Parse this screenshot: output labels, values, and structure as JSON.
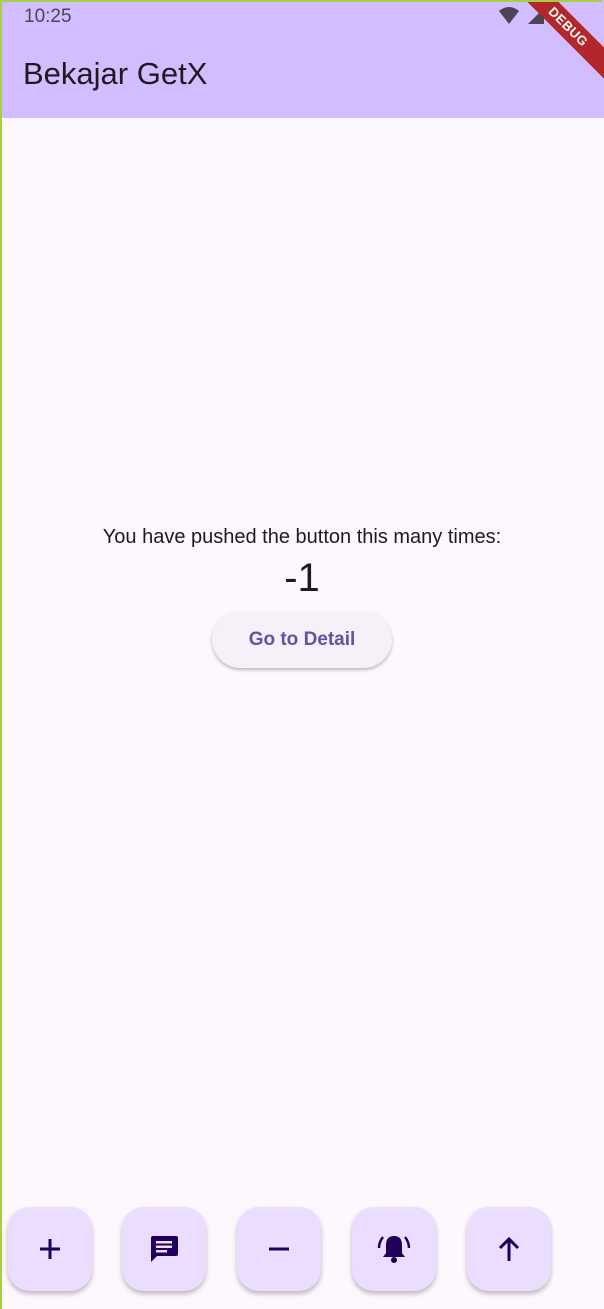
{
  "status_bar": {
    "time": "10:25",
    "icons": [
      "wifi-icon",
      "signal-icon",
      "battery-icon"
    ]
  },
  "app_bar": {
    "title": "Bekajar GetX",
    "debug_banner": "DEBUG"
  },
  "main": {
    "message": "You have pushed the button this many times:",
    "counter": "-1",
    "detail_button_label": "Go to Detail"
  },
  "fabs": [
    {
      "name": "add-fab",
      "icon": "plus-icon"
    },
    {
      "name": "message-fab",
      "icon": "message-icon"
    },
    {
      "name": "remove-fab",
      "icon": "minus-icon"
    },
    {
      "name": "alarm-fab",
      "icon": "bell-ringing-icon"
    },
    {
      "name": "navigate-fab",
      "icon": "arrow-up-icon"
    }
  ],
  "colors": {
    "app_bar": "#d1bdff",
    "background": "#fdf7fe",
    "fab": "#eaddff",
    "fab_icon": "#21005d",
    "button_text": "#6750a4",
    "debug_banner": "#b3262a"
  }
}
